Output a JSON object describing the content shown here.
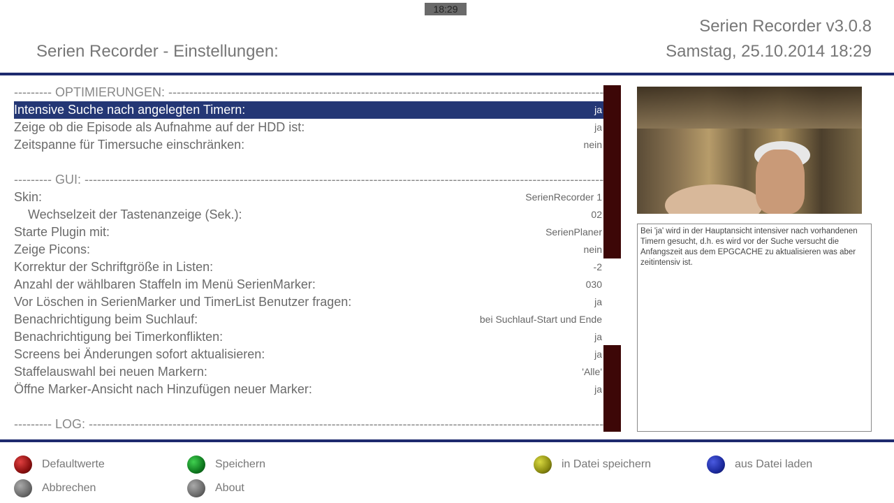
{
  "header": {
    "clock": "18:29",
    "title": "Serien Recorder - Einstellungen:",
    "version": "Serien Recorder v3.0.8",
    "datetime": "Samstag, 25.10.2014  18:29"
  },
  "settings": {
    "section_optimierungen": "--------- OPTIMIERUNGEN: --------------------------------------------------------------------------------------------------------------------",
    "section_gui": "--------- GUI: -------------------------------------------------------------------------------------------------------------------------------------",
    "section_log": "--------- LOG: -------------------------------------------------------------------------------------------------------------------------------------",
    "rows": [
      {
        "label": "Intensive Suche nach angelegten Timern:",
        "value": "ja"
      },
      {
        "label": "Zeige ob die Episode als Aufnahme auf der HDD ist:",
        "value": "ja"
      },
      {
        "label": "Zeitspanne für Timersuche einschränken:",
        "value": "nein"
      },
      {
        "label": "Skin:",
        "value": "SerienRecorder 1"
      },
      {
        "label": "Wechselzeit der Tastenanzeige (Sek.):",
        "value": "02"
      },
      {
        "label": "Starte Plugin mit:",
        "value": "SerienPlaner"
      },
      {
        "label": "Zeige Picons:",
        "value": "nein"
      },
      {
        "label": "Korrektur der Schriftgröße in Listen:",
        "value": "-2"
      },
      {
        "label": "Anzahl der wählbaren Staffeln im Menü SerienMarker:",
        "value": "030"
      },
      {
        "label": "Vor Löschen in SerienMarker und TimerList Benutzer fragen:",
        "value": "ja"
      },
      {
        "label": "Benachrichtigung beim Suchlauf:",
        "value": "bei Suchlauf-Start und Ende"
      },
      {
        "label": "Benachrichtigung bei Timerkonflikten:",
        "value": "ja"
      },
      {
        "label": "Screens bei Änderungen sofort aktualisieren:",
        "value": "ja"
      },
      {
        "label": "Staffelauswahl bei neuen Markern:",
        "value": "'Alle'"
      },
      {
        "label": "Öffne Marker-Ansicht nach Hinzufügen neuer Marker:",
        "value": "ja"
      }
    ]
  },
  "help_text": "Bei 'ja' wird in der Hauptansicht intensiver nach vorhandenen Timern gesucht, d.h. es wird vor der Suche versucht die Anfangszeit aus dem EPGCACHE zu aktualisieren was aber zeitintensiv ist.",
  "buttons": {
    "red": "Defaultwerte",
    "green": "Speichern",
    "yellow": "in Datei speichern",
    "blue": "aus Datei laden",
    "exit": "Abbrechen",
    "info": "About"
  },
  "colors": {
    "header_bar": "#1e2a6e",
    "selected_row": "#243775",
    "scrollbar": "#3d0707",
    "red": "#8b1010",
    "green": "#0f7a1f",
    "yellow": "#8a8a10",
    "blue": "#1c2a9e",
    "grey": "#6a6a6a"
  }
}
